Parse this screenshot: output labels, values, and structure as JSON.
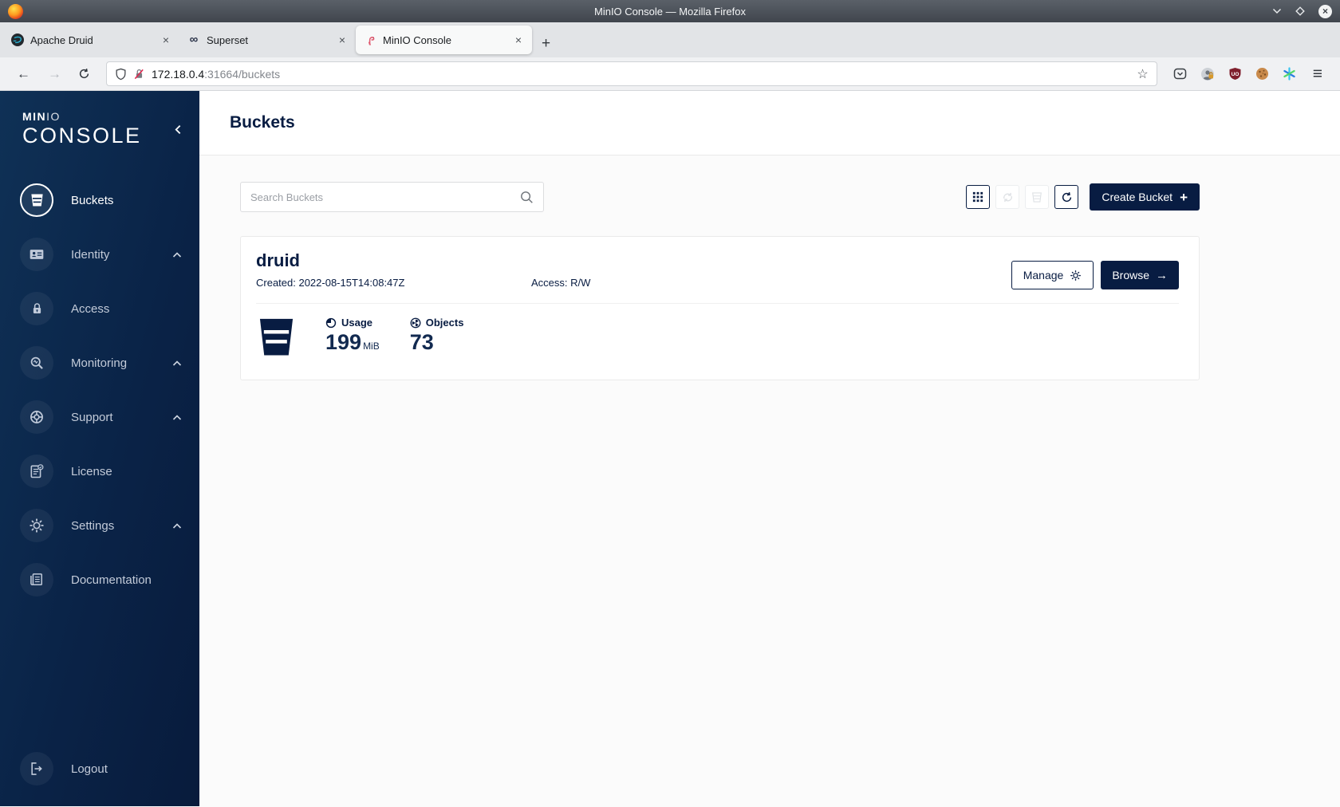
{
  "window": {
    "title": "MinIO Console — Mozilla Firefox"
  },
  "icons": {
    "back": "←",
    "forward": "→",
    "menu": "≡",
    "star": "☆",
    "close": "×",
    "new_tab": "+",
    "plus": "+",
    "infinity": "∞",
    "browse_arrow": "→",
    "window_close": "×"
  },
  "browser": {
    "tabs": [
      {
        "label": "Apache Druid"
      },
      {
        "label": "Superset"
      },
      {
        "label": "MinIO Console"
      }
    ],
    "url": {
      "host": "172.18.0.4",
      "rest": ":31664/buckets"
    }
  },
  "sidebar": {
    "logo": {
      "min": "MIN",
      "io": "IO",
      "console": "CONSOLE"
    },
    "items": [
      {
        "label": "Buckets"
      },
      {
        "label": "Identity"
      },
      {
        "label": "Access"
      },
      {
        "label": "Monitoring"
      },
      {
        "label": "Support"
      },
      {
        "label": "License"
      },
      {
        "label": "Settings"
      },
      {
        "label": "Documentation"
      }
    ],
    "logout_label": "Logout"
  },
  "main": {
    "page_title": "Buckets",
    "toolbar": {
      "search_placeholder": "Search Buckets",
      "create_bucket_label": "Create Bucket"
    },
    "bucket": {
      "name": "druid",
      "created": "Created: 2022-08-15T14:08:47Z",
      "access": "Access: R/W",
      "manage_label": "Manage",
      "browse_label": "Browse",
      "stats": {
        "usage_label": "Usage",
        "usage_value": "199",
        "usage_unit": "MiB",
        "objects_label": "Objects",
        "objects_value": "73"
      }
    }
  },
  "colors": {
    "brand_navy": "#081C42",
    "sidebar_gradient_start": "#0F3156",
    "sidebar_gradient_end": "#081B3C",
    "insecure_strike": "#E22850"
  }
}
